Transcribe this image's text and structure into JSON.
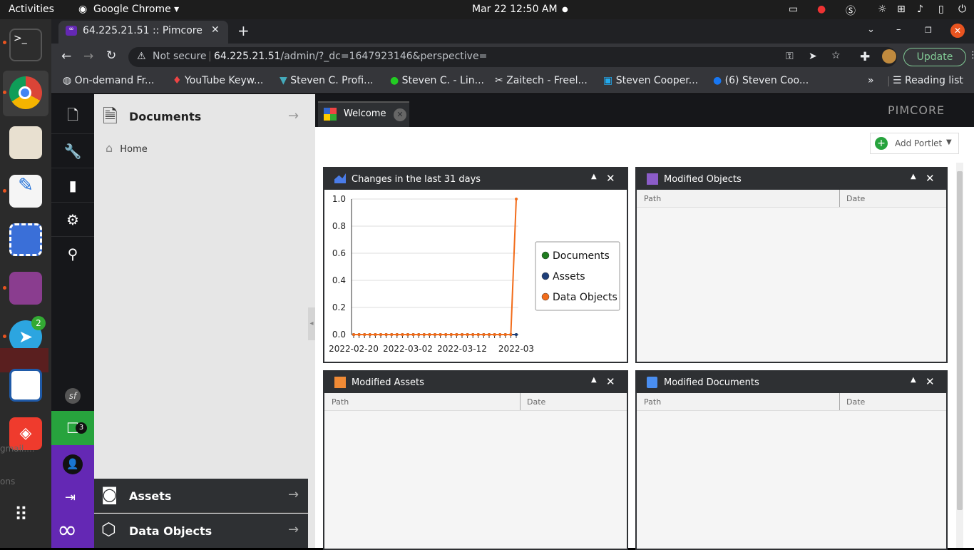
{
  "topbar": {
    "activities": "Activities",
    "app": "Google Chrome",
    "datetime": "Mar 22  12:50 AM"
  },
  "dock": {
    "telegram_badge": "2",
    "clipped_labels": [
      "gmail....",
      "ons"
    ]
  },
  "chrome": {
    "tab_title": "64.225.21.51 :: Pimcore",
    "not_secure": "Not secure",
    "url_host": "64.225.21.51",
    "url_path": "/admin/?_dc=1647923146&perspective=",
    "update_label": "Update",
    "bookmarks": [
      "On-demand Fr...",
      "YouTube Keyw...",
      "Steven C. Profi...",
      "Steven C. - Lin...",
      "Zaitech - Freel...",
      "Steven Cooper...",
      "(6) Steven Coo..."
    ],
    "reading_list": "Reading list"
  },
  "pimcore": {
    "chat_badge": "3",
    "tree": {
      "documents_title": "Documents",
      "home": "Home",
      "assets_title": "Assets",
      "objects_title": "Data Objects"
    },
    "main_tab": "Welcome",
    "brand": "PIMCORE",
    "add_portlet": "Add Portlet",
    "portlets": {
      "changes": {
        "title": "Changes in the last 31 days"
      },
      "modified_objects": {
        "title": "Modified Objects",
        "col_path": "Path",
        "col_date": "Date"
      },
      "modified_assets": {
        "title": "Modified Assets",
        "col_path": "Path",
        "col_date": "Date"
      },
      "modified_documents": {
        "title": "Modified Documents",
        "col_path": "Path",
        "col_date": "Date"
      }
    }
  },
  "chart_data": {
    "type": "line",
    "title": "Changes in the last 31 days",
    "x_tick_labels": [
      "2022-02-20",
      "2022-03-02",
      "2022-03-12",
      "2022-03"
    ],
    "y_tick_labels": [
      "0.0",
      "0.2",
      "0.4",
      "0.6",
      "0.8",
      "1.0"
    ],
    "ylim": [
      0,
      1
    ],
    "grid": true,
    "legend_position": "right",
    "series": [
      {
        "name": "Documents",
        "color": "#1e7b1e",
        "values": [
          0,
          0,
          0,
          0,
          0,
          0,
          0,
          0,
          0,
          0,
          0,
          0,
          0,
          0,
          0,
          0,
          0,
          0,
          0,
          0,
          0,
          0,
          0,
          0,
          0,
          0,
          0,
          0,
          0,
          0,
          0
        ]
      },
      {
        "name": "Assets",
        "color": "#1f3f7a",
        "values": [
          0,
          0,
          0,
          0,
          0,
          0,
          0,
          0,
          0,
          0,
          0,
          0,
          0,
          0,
          0,
          0,
          0,
          0,
          0,
          0,
          0,
          0,
          0,
          0,
          0,
          0,
          0,
          0,
          0,
          0,
          0
        ]
      },
      {
        "name": "Data Objects",
        "color": "#f26c1a",
        "values": [
          0,
          0,
          0,
          0,
          0,
          0,
          0,
          0,
          0,
          0,
          0,
          0,
          0,
          0,
          0,
          0,
          0,
          0,
          0,
          0,
          0,
          0,
          0,
          0,
          0,
          0,
          0,
          0,
          0,
          0,
          1
        ]
      }
    ]
  }
}
